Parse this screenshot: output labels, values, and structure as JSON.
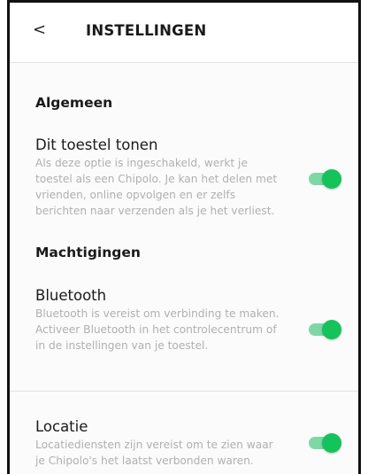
{
  "header": {
    "back_glyph": "<",
    "title": "INSTELLINGEN"
  },
  "sections": {
    "general": {
      "title": "Algemeen",
      "show_device": {
        "title": "Dit toestel tonen",
        "description": "Als deze optie is ingeschakeld, werkt je toestel als een Chipolo. Je kan het delen met vrienden, online opvolgen en er zelfs berichten naar verzenden als je het verliest.",
        "enabled": true
      }
    },
    "permissions": {
      "title": "Machtigingen",
      "bluetooth": {
        "title": "Bluetooth",
        "description": "Bluetooth is vereist om verbinding te maken. Activeer Bluetooth in het controlecentrum of in de instellingen van je toestel.",
        "enabled": true
      },
      "location": {
        "title": "Locatie",
        "description": "Locatiediensten zijn vereist om te zien waar je Chipolo's het laatst verbonden waren.",
        "enabled": true
      }
    }
  },
  "colors": {
    "toggle_on": "#14c35a",
    "toggle_track": "#7fd7a6"
  }
}
